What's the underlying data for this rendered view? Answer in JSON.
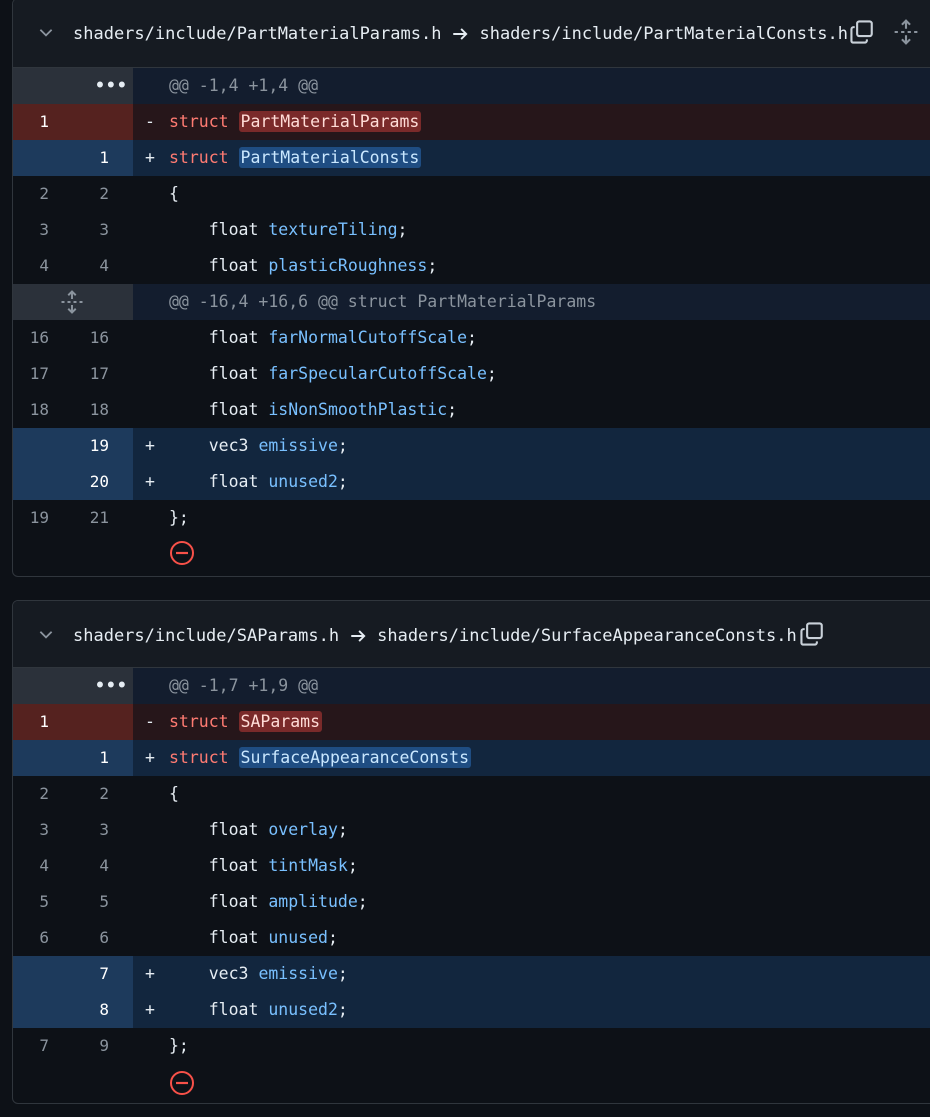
{
  "files": [
    {
      "old_path": "shaders/include/PartMaterialParams.h",
      "new_path": "shaders/include/PartMaterialConsts.h",
      "rows": [
        {
          "type": "hunk",
          "old": "",
          "new": "",
          "sign": "",
          "text": "@@ -1,4 +1,4 @@",
          "expander": "dots"
        },
        {
          "type": "del",
          "old": "1",
          "new": "",
          "sign": "-",
          "kw": "struct",
          "name": "PartMaterialParams"
        },
        {
          "type": "add",
          "old": "",
          "new": "1",
          "sign": "+",
          "kw": "struct",
          "name": "PartMaterialConsts"
        },
        {
          "type": "ctx",
          "old": "2",
          "new": "2",
          "sign": "",
          "plain": "{"
        },
        {
          "type": "ctx",
          "old": "3",
          "new": "3",
          "sign": "",
          "indent": "    ",
          "t": "float",
          "id": "textureTiling",
          "tail": ";"
        },
        {
          "type": "ctx",
          "old": "4",
          "new": "4",
          "sign": "",
          "indent": "    ",
          "t": "float",
          "id": "plasticRoughness",
          "tail": ";"
        },
        {
          "type": "hunk",
          "old": "",
          "new": "",
          "sign": "",
          "text": "@@ -16,4 +16,6 @@ struct PartMaterialParams",
          "expander": "expand"
        },
        {
          "type": "ctx",
          "old": "16",
          "new": "16",
          "sign": "",
          "indent": "    ",
          "t": "float",
          "id": "farNormalCutoffScale",
          "tail": ";"
        },
        {
          "type": "ctx",
          "old": "17",
          "new": "17",
          "sign": "",
          "indent": "    ",
          "t": "float",
          "id": "farSpecularCutoffScale",
          "tail": ";"
        },
        {
          "type": "ctx",
          "old": "18",
          "new": "18",
          "sign": "",
          "indent": "    ",
          "t": "float",
          "id": "isNonSmoothPlastic",
          "tail": ";"
        },
        {
          "type": "add",
          "old": "",
          "new": "19",
          "sign": "+",
          "indent": "    ",
          "t": "vec3",
          "id": "emissive",
          "tail": ";"
        },
        {
          "type": "add",
          "old": "",
          "new": "20",
          "sign": "+",
          "indent": "    ",
          "t": "float",
          "id": "unused2",
          "tail": ";"
        },
        {
          "type": "ctx",
          "old": "19",
          "new": "21",
          "sign": "",
          "plain": "};"
        }
      ]
    },
    {
      "old_path": "shaders/include/SAParams.h",
      "new_path": "shaders/include/SurfaceAppearanceConsts.h",
      "rows": [
        {
          "type": "hunk",
          "old": "",
          "new": "",
          "sign": "",
          "text": "@@ -1,7 +1,9 @@",
          "expander": "dots"
        },
        {
          "type": "del",
          "old": "1",
          "new": "",
          "sign": "-",
          "kw": "struct",
          "name": "SAParams"
        },
        {
          "type": "add",
          "old": "",
          "new": "1",
          "sign": "+",
          "kw": "struct",
          "name": "SurfaceAppearanceConsts"
        },
        {
          "type": "ctx",
          "old": "2",
          "new": "2",
          "sign": "",
          "plain": "{"
        },
        {
          "type": "ctx",
          "old": "3",
          "new": "3",
          "sign": "",
          "indent": "    ",
          "t": "float",
          "id": "overlay",
          "tail": ";"
        },
        {
          "type": "ctx",
          "old": "4",
          "new": "4",
          "sign": "",
          "indent": "    ",
          "t": "float",
          "id": "tintMask",
          "tail": ";"
        },
        {
          "type": "ctx",
          "old": "5",
          "new": "5",
          "sign": "",
          "indent": "    ",
          "t": "float",
          "id": "amplitude",
          "tail": ";"
        },
        {
          "type": "ctx",
          "old": "6",
          "new": "6",
          "sign": "",
          "indent": "    ",
          "t": "float",
          "id": "unused",
          "tail": ";"
        },
        {
          "type": "add",
          "old": "",
          "new": "7",
          "sign": "+",
          "indent": "    ",
          "t": "vec3",
          "id": "emissive",
          "tail": ";"
        },
        {
          "type": "add",
          "old": "",
          "new": "8",
          "sign": "+",
          "indent": "    ",
          "t": "float",
          "id": "unused2",
          "tail": ";"
        },
        {
          "type": "ctx",
          "old": "7",
          "new": "9",
          "sign": "",
          "plain": "};"
        }
      ]
    }
  ],
  "dots_glyph": "•••",
  "colors": {
    "deleted": "#55221f",
    "added": "#1d3a5c",
    "keyword": "#ff7b72",
    "identifier": "#79c0ff",
    "remove_icon": "#f85149"
  },
  "icons": {
    "collapse": "chevron-down-icon",
    "rename": "arrow-right-icon",
    "copy": "copy-icon",
    "expand": "unfold-icon",
    "comment_remove": "minus-circle-icon"
  }
}
